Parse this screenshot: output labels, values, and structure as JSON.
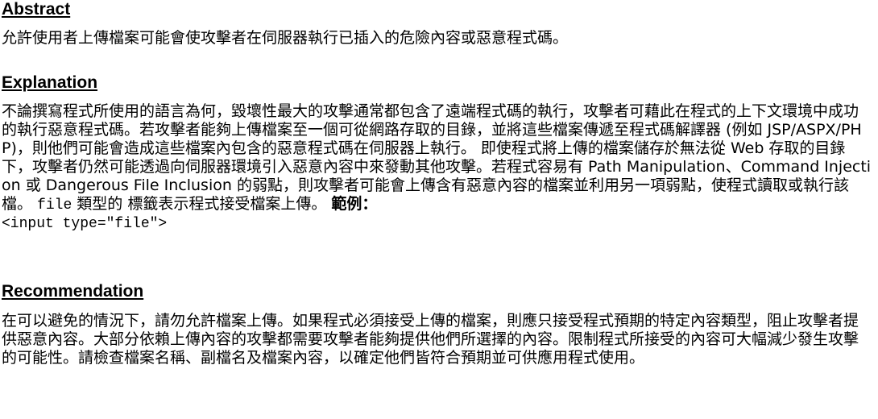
{
  "abstract": {
    "heading": "Abstract",
    "text": "允許使用者上傳檔案可能會使攻擊者在伺服器執行已插入的危險內容或惡意程式碼。"
  },
  "explanation": {
    "heading": "Explanation",
    "text_main": "不論撰寫程式所使用的語言為何，毀壞性最大的攻擊通常都包含了遠端程式碼的執行，攻擊者可藉此在程式的上下文環境中成功的執行惡意程式碼。若攻擊者能夠上傳檔案至一個可從網路存取的目錄，並將這些檔案傳遞至程式碼解譯器 (例如 JSP/ASPX/PHP)，則他們可能會造成這些檔案內包含的惡意程式碼在伺服器上執行。 即使程式將上傳的檔案儲存於無法從 Web 存取的目錄下，攻擊者仍然可能透過向伺服器環境引入惡意內容中來發動其他攻擊。若程式容易有 Path Manipulation、Command Injection 或 Dangerous File Inclusion 的弱點，則攻擊者可能會上傳含有惡意內容的檔案並利用另一項弱點，使程式讀取或執行該檔。 ",
    "inline_code": "file",
    "text_after_code": " 類型的 標籤表示程式接受檔案上傳。 ",
    "example_label": "範例：",
    "code_example": "<input type=\"file\">"
  },
  "recommendation": {
    "heading": "Recommendation",
    "text": "在可以避免的情況下，請勿允許檔案上傳。如果程式必須接受上傳的檔案，則應只接受程式預期的特定內容類型，阻止攻擊者提供惡意內容。大部分依賴上傳內容的攻擊都需要攻擊者能夠提供他們所選擇的內容。限制程式所接受的內容可大幅減少發生攻擊的可能性。請檢查檔案名稱、副檔名及檔案內容，以確定他們皆符合預期並可供應用程式使用。"
  }
}
